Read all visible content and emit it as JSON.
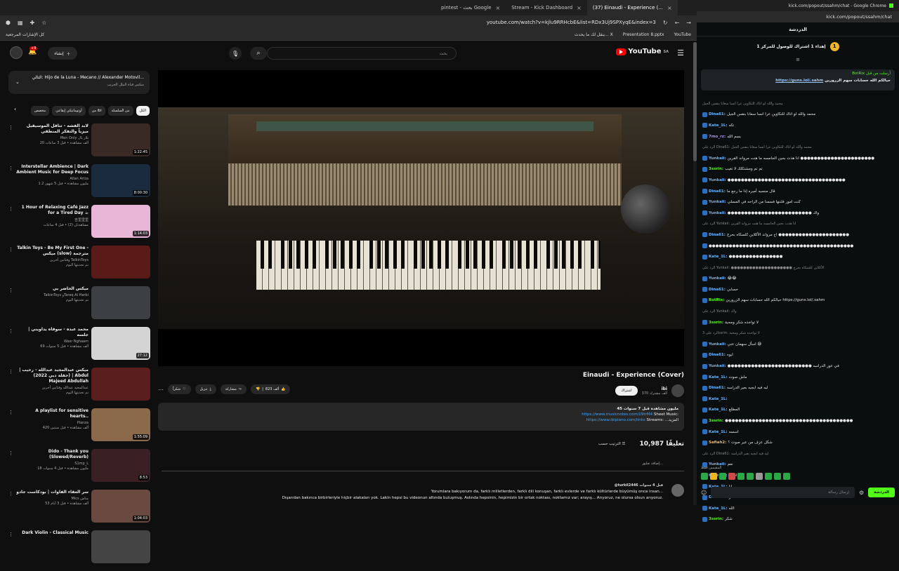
{
  "browser": {
    "tabs": [
      {
        "label": "pintest - بحث Google"
      },
      {
        "label": "Stream - Kick Dashboard"
      },
      {
        "label": "(37) Einaudi - Experience (..."
      }
    ],
    "url": "youtube.com/watch?v=kjlu9RRHcbE&list=RDx3Uj9SPXyqE&index=3",
    "bookmarks_folder": "كل الإشارات المرجعية",
    "bookmarks": [
      {
        "label": "YouTube"
      },
      {
        "label": "Presentation 8.pptx"
      },
      {
        "label": "ينقل لك ما يحدث... X"
      }
    ]
  },
  "youtube": {
    "logo": "YouTube",
    "logo_region": "SA",
    "search_placeholder": "بحث",
    "create_label": "إنشاء",
    "notif_count": "+9",
    "playlist": {
      "title": "التالي: Hijo de la Luna - Mecano // Alexander Motovil...",
      "subtitle": "ميكس قناة الملل الجريب"
    },
    "chips": [
      "الكل",
      "من السلسلة",
      "من ibi",
      "أوتوماتيكي إيقاعي",
      "مخصص"
    ],
    "recommendations": [
      {
        "title": "لابد الفشه - تناقل الموسيقيل ميزياً والتفكر المنطقي",
        "channel": "Men Only تلار يال",
        "meta": "20 ألف مشاهدة • قبل 3 ساعات",
        "duration": "1:22:45",
        "color": "#3a2a26"
      },
      {
        "title": "Interstellar Ambience | Dark Ambient Music for Deep Focus",
        "channel": "Allan Ariza",
        "meta": "1.2 مليون مشاهدة • قبل 5 شهور",
        "duration": "8:00:30",
        "color": "#1b2b3e"
      },
      {
        "title": "1 Hour of Relaxing Café Jazz for a Tired Day ☕",
        "channel": "吉里里里",
        "meta": "مشاهدتان (2) • قبل 4 ساعات",
        "duration": "1:14:03",
        "color": "#e8b7d8"
      },
      {
        "title": "Talkin Toys - Be My First One - ميكس (slow) مترجمة",
        "channel": "وفنانين آخرين TalkinToys",
        "meta": "تم تحديثها اليوم",
        "duration": "",
        "color": "#5a1a18"
      },
      {
        "title": "ميكس الحاضر بي",
        "channel": "TalkinToys وTareq Al Harbi",
        "meta": "تم تحديثها اليوم",
        "duration": "",
        "color": "#3c4045"
      },
      {
        "title": "محمد عبده - سوقاه يداويني | جلسه",
        "channel": "Wasr Nghaam",
        "meta": "69 ألف مشاهدة • قبل 5 سنوات",
        "duration": "27:12",
        "color": "#d4d4d4"
      },
      {
        "title": "ميكس عبدالمجيد عبدالله - رحيب | (حفلة دبي 2022) | Abdul Majeed Abdullah",
        "channel": "عبدالمجيد عبدالله وفنانين آخرين",
        "meta": "تم تحديثها اليوم",
        "duration": "",
        "color": "#5b1e1e"
      },
      {
        "title": "A playlist for sensitive hearts..",
        "channel": "Pianza",
        "meta": "420 ألف مشاهدة • قبل سنتين",
        "duration": "1:55:09",
        "color": "#8a6a4a"
      },
      {
        "title": "Dido - Thank you (Slowed/Reverb)",
        "channel": "S1mp_L",
        "meta": "18 مليون مشاهدة • قبل 4 سنوات",
        "duration": "8:53",
        "color": "#3a2022"
      },
      {
        "title": "سر العقاء الفاوات | بودكاست جادو",
        "channel": "Mics مناش",
        "meta": "53 ألف مشاهدة • قبل 3 أيام",
        "duration": "1:04:03",
        "color": "#6a4a40"
      },
      {
        "title": "Dark Violin - Classical Music",
        "channel": "",
        "meta": "",
        "duration": "",
        "color": "#444"
      }
    ],
    "video": {
      "title": "Einaudi - Experience (Cover)",
      "channel": "ibi",
      "subs": "370 ألف مشترك",
      "subscribe": "اشتراك",
      "likes": "823 ألف",
      "share": "مشاركة",
      "download": "تنزيل",
      "thanks": "شكراً",
      "views_line": "45 مليون مشاهدة قبل 7 سنوات",
      "sheet_label": "Sheet Music:",
      "sheet_link": "https://www.musicnotes.com/l/9trM4",
      "streams_label": "Streams: ...المزيد",
      "streams_link": "https://www.ibipiano.com/links"
    },
    "comments": {
      "count": "10,987 تعليقًا",
      "sort": "الترتيب حسب",
      "add_placeholder": "إضافة تعليق...",
      "first_author": "@turkil2446 قبل 4 سنوات",
      "first_text_1": "Yorumlara bakıyorum da, farklı milletlerden, farklı dili konuşan, farklı evlerde ve farklı kültürlerde büyümüş onca insan...",
      "first_text_2": "Dışarıdan bakınca birbirleriyle hiçbir alakaları yok. Lakin hepsi bu videonun altında buluşmuş. Aslında hepsinin, hepimizin bir ortak noktası, noktamız var; arayış... Arıyoruz, ne olursa olsun arıyoruz."
    }
  },
  "kick": {
    "window_title": "kick.com/popout/ssahm/chat - Google Chrome",
    "url": "kick.com/popout/ssahm/chat",
    "chat_title": "الدردشة",
    "goal": "إهداء 1 اشتراك للوصول للمركز 1",
    "goal_rank": "1",
    "pinned_by": "BotRix أرسلت من قبل",
    "pinned_msg": "حيالكم الله حسابات سهم الزرورين",
    "pinned_link": "https://guns.lol/.sahm",
    "messages": [
      {
        "user": "",
        "text": "محمد والله لو اتاك للتكاوين عرا انسا سعانا بنفس الجيل",
        "cls": "u-blue",
        "reply": true
      },
      {
        "user": "Dina61:",
        "text": "محمد والله لو اتاك للتكاوين عرا انسا سعانا بنفس الجيل",
        "cls": "u-blue"
      },
      {
        "user": "Kate_1L:",
        "text": "تكه",
        "cls": "u-blue"
      },
      {
        "user": "7mo_rz:",
        "text": "بسم الله",
        "cls": "u-purple"
      },
      {
        "user": "",
        "text": "الرد على Dina61: محمد والله لو اتاك للتكاوين عرا انسا سعانا بنفس الجيل",
        "cls": "u-blue",
        "reply": true
      },
      {
        "user": "Yunkaii:",
        "text": "انا هذت بحين الجامسه ما هنت مرواند القرين ●●●●●●●●●●●●●●●●●●●●●●",
        "cls": "u-blue"
      },
      {
        "user": "3ssrin:",
        "text": "تم تم ومشتكلك لا تغيب",
        "cls": "u-green"
      },
      {
        "user": "Yunkaii:",
        "text": "●●●●●●●●●●●●●●●●●●●●●●●●●●●●●●●●●●●",
        "cls": "u-blue"
      },
      {
        "user": "Dina61:",
        "text": "قال منسيه أميره إذا ما رجع ما",
        "cls": "u-blue"
      },
      {
        "user": "Yunkaii:",
        "text": "كنت امور فلننها فسمنا من الراحه في المسلي",
        "cls": "u-blue"
      },
      {
        "user": "Yunkaii:",
        "text": "●●●●●●●●●●●●●●●●●●●●●●●●● واك",
        "cls": "u-blue"
      },
      {
        "user": "",
        "text": "الرد على Yunkaii: انا هذت بحين الجامسه ما هنت مرواند القرين",
        "cls": "u-blue",
        "reply": true
      },
      {
        "user": "Dina61:",
        "text": "اخ مرواند الأكلاين كلسكاه بحرج ●●●●●●●●●●●●●●●●●●●●●",
        "cls": "u-blue"
      },
      {
        "user": "",
        "text": "●●●●●●●●●●●●●●●●●●●●●●●●●●●●●●●●●●●●●●●●●●●",
        "cls": "u-blue"
      },
      {
        "user": "Kate_1L:",
        "text": "●●●●●●●●●●●●●●●●",
        "cls": "u-blue"
      },
      {
        "user": "",
        "text": "الرد على Yunkaii: ●●●●●●●●●●●●●●●●●●●● الأكلاين كلسكاه بحرج",
        "cls": "u-blue",
        "reply": true
      },
      {
        "user": "Yunkaii:",
        "text": "😂😂",
        "cls": "u-blue"
      },
      {
        "user": "Dina61:",
        "text": "حسابي",
        "cls": "u-blue"
      },
      {
        "user": "BotRix:",
        "text": "حيالكم الله حسابات سهم الزرورين https://guns.lol/.sahm",
        "cls": "u-green"
      },
      {
        "user": "",
        "text": "الرد على Yunkaii: واك",
        "cls": "u-blue",
        "reply": true
      },
      {
        "user": "3ssrin:",
        "text": "لا تواخذه شكر ومحبة",
        "cls": "u-green"
      },
      {
        "user": "",
        "text": "الرد على 3ssrin: لا تواخذه شكر ومحبة",
        "cls": "u-blue",
        "reply": true
      },
      {
        "user": "Yunkaii:",
        "text": "اسأل سهمان عني 😅",
        "cls": "u-blue"
      },
      {
        "user": "Dina61:",
        "text": "ايوه",
        "cls": "u-blue"
      },
      {
        "user": "Yunkaii:",
        "text": "●●●●●●●●●●●●●●●●●●●●●●●●● في عور الدراسه",
        "cls": "u-blue"
      },
      {
        "user": "Kate_1L:",
        "text": "ماش صوت",
        "cls": "u-blue"
      },
      {
        "user": "Dina61:",
        "text": "ليه فيه ابجيه بعير الدراسه",
        "cls": "u-blue"
      },
      {
        "user": "Kate_1L:",
        "text": "",
        "cls": "u-blue"
      },
      {
        "user": "Kate_1L:",
        "text": "المطلع",
        "cls": "u-blue"
      },
      {
        "user": "3ssrin:",
        "text": "●●●●●●●●●●●●●●●●●●●●●●●●●●●●●●●●●●●●●●",
        "cls": "u-green"
      },
      {
        "user": "Kate_1L:",
        "text": "اسسه",
        "cls": "u-blue"
      },
      {
        "user": "Safiah2:",
        "text": "شكل عزف من عير صوت ؟",
        "cls": "u-orange"
      },
      {
        "user": "",
        "text": "الرد على Dina61: ليه فيه ابجيه بعير الدراسه",
        "cls": "u-blue",
        "reply": true
      },
      {
        "user": "Yunkaii:",
        "text": "نعم",
        "cls": "u-blue"
      },
      {
        "user": "Kate_1L:",
        "text": "اقصد",
        "cls": "u-blue"
      },
      {
        "user": "Kate_1L:",
        "text": "انا",
        "cls": "u-blue"
      },
      {
        "user": "Dina61:",
        "text": "شنو؟",
        "cls": "u-blue"
      },
      {
        "user": "Kate_1L:",
        "text": "الله",
        "cls": "u-blue"
      },
      {
        "user": "3ssrin:",
        "text": "شكر",
        "cls": "u-green"
      }
    ],
    "hint": "المقيمين فقط",
    "input_placeholder": "إرسال رسالة",
    "send_label": "الدردشة"
  }
}
